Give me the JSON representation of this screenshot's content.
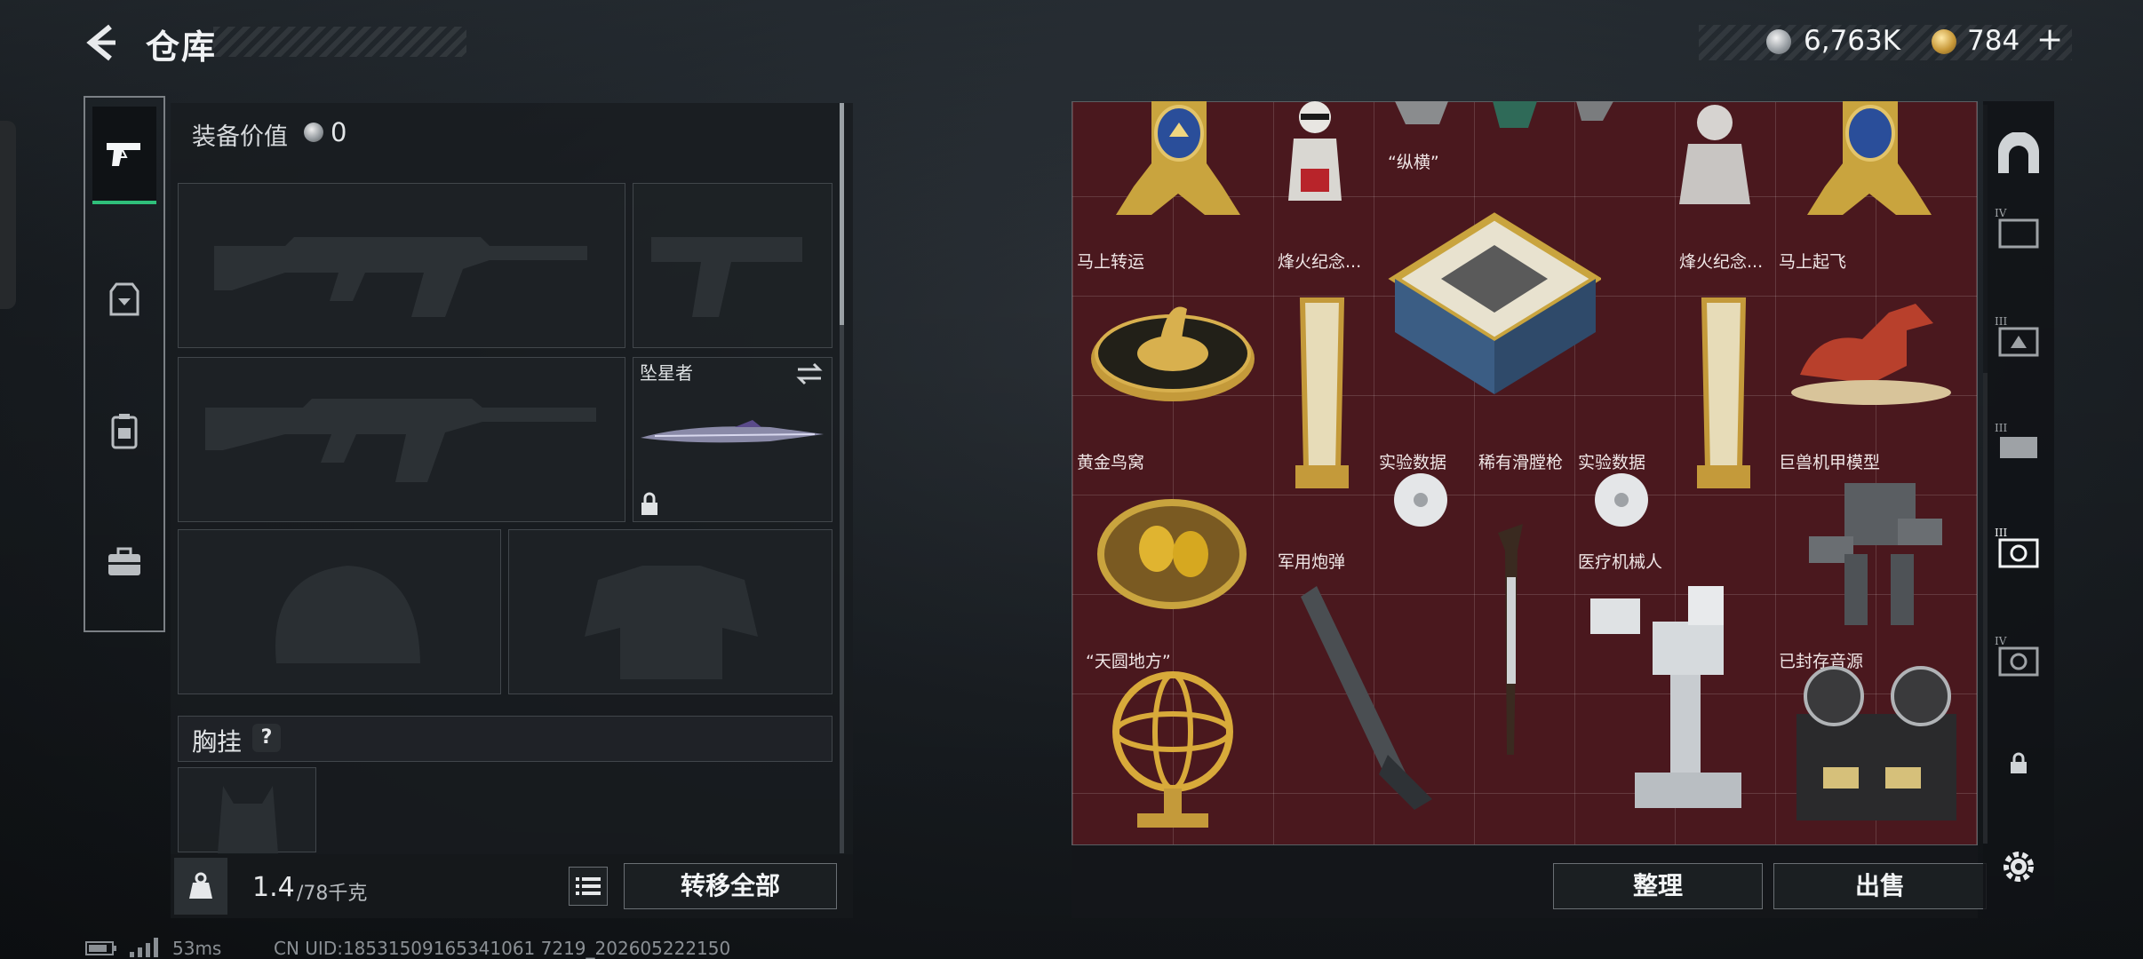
{
  "header": {
    "title": "仓库",
    "currency": {
      "silver_amount": "6,763K",
      "gold_amount": "784",
      "gold_plus": "+"
    }
  },
  "left_tabs": [
    {
      "icon": "pistol-icon",
      "active": true
    },
    {
      "icon": "armor-icon",
      "active": false
    },
    {
      "icon": "backpack-icon",
      "active": false
    },
    {
      "icon": "toolbox-icon",
      "active": false
    }
  ],
  "equipment": {
    "value_label": "装备价值",
    "value_amount": "0",
    "melee_name": "坠星者",
    "chest_rig_label": "胸挂",
    "chest_rig_help": "?",
    "weight_value": "1.4",
    "weight_unit": "/78千克",
    "transfer_all": "转移全部"
  },
  "storage": {
    "items": [
      {
        "name": "“纵横”"
      },
      {
        "name": "马上转运"
      },
      {
        "name": "烽火纪念..."
      },
      {
        "name": "烽火纪念..."
      },
      {
        "name": "马上起飞"
      },
      {
        "name": "黄金鸟窝"
      },
      {
        "name": "实验数据"
      },
      {
        "name": "稀有滑膛枪"
      },
      {
        "name": "实验数据"
      },
      {
        "name": "巨兽机甲模型"
      },
      {
        "name": "军用炮弹"
      },
      {
        "name": "医疗机械人"
      },
      {
        "name": "“天圆地方”"
      },
      {
        "name": "已封存音源"
      }
    ],
    "sort_label": "整理",
    "sell_label": "出售"
  },
  "right_tabs": [
    {
      "icon": "storage-arch-icon"
    },
    {
      "icon": "tier4-storage-icon",
      "tier": "IV"
    },
    {
      "icon": "tier3-storage-icon",
      "tier": "III"
    },
    {
      "icon": "tier3-case-icon",
      "tier": "III"
    },
    {
      "icon": "tier3-safe-icon",
      "tier": "III",
      "active": true
    },
    {
      "icon": "tier4-safe-icon",
      "tier": "IV"
    },
    {
      "icon": "lock-icon"
    },
    {
      "icon": "settings-gear-icon"
    }
  ],
  "status_bar": {
    "ping": "53ms",
    "uid": "CN UID:18531509165341061 7219_202605222150"
  },
  "colors": {
    "accent_green": "#2fbf7a",
    "grid_red": "#4a181e",
    "gold": "#c99a3b"
  }
}
